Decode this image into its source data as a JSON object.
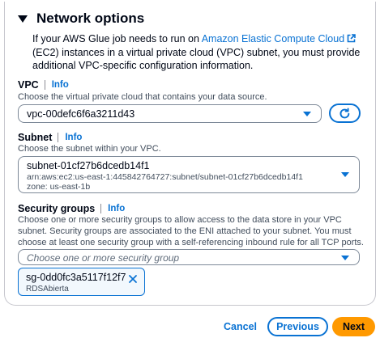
{
  "section": {
    "title": "Network options",
    "desc_before": "If your AWS Glue job needs to run on ",
    "desc_link": "Amazon Elastic Compute Cloud",
    "desc_after": " (EC2) instances in a virtual private cloud (VPC) subnet, you must provide additional VPC-specific configuration information."
  },
  "vpc": {
    "label": "VPC",
    "info": "Info",
    "description": "Choose the virtual private cloud that contains your data source.",
    "value": "vpc-00defc6f6a3211d43"
  },
  "subnet": {
    "label": "Subnet",
    "info": "Info",
    "description": "Choose the subnet within your VPC.",
    "value": "subnet-01cf27b6dcedb14f1",
    "arn": "arn:aws:ec2:us-east-1:445842764727:subnet/subnet-01cf27b6dcedb14f1",
    "zone": "zone: us-east-1b"
  },
  "security_groups": {
    "label": "Security groups",
    "info": "Info",
    "description": "Choose one or more security groups to allow access to the data store in your VPC subnet. Security groups are associated to the ENI attached to your subnet. You must choose at least one security group with a self-referencing inbound rule for all TCP ports.",
    "placeholder": "Choose one or more security group",
    "token": {
      "label": "sg-0dd0fc3a5117f12f7",
      "name": "RDSAbierta"
    }
  },
  "footer": {
    "cancel": "Cancel",
    "previous": "Previous",
    "next": "Next"
  },
  "colors": {
    "link": "#0972d3",
    "primary_button": "#ff9900",
    "text": "#000716"
  },
  "icons": [
    "external-link-icon",
    "refresh-icon",
    "chevron-down-icon",
    "close-icon",
    "caret-down-icon"
  ]
}
